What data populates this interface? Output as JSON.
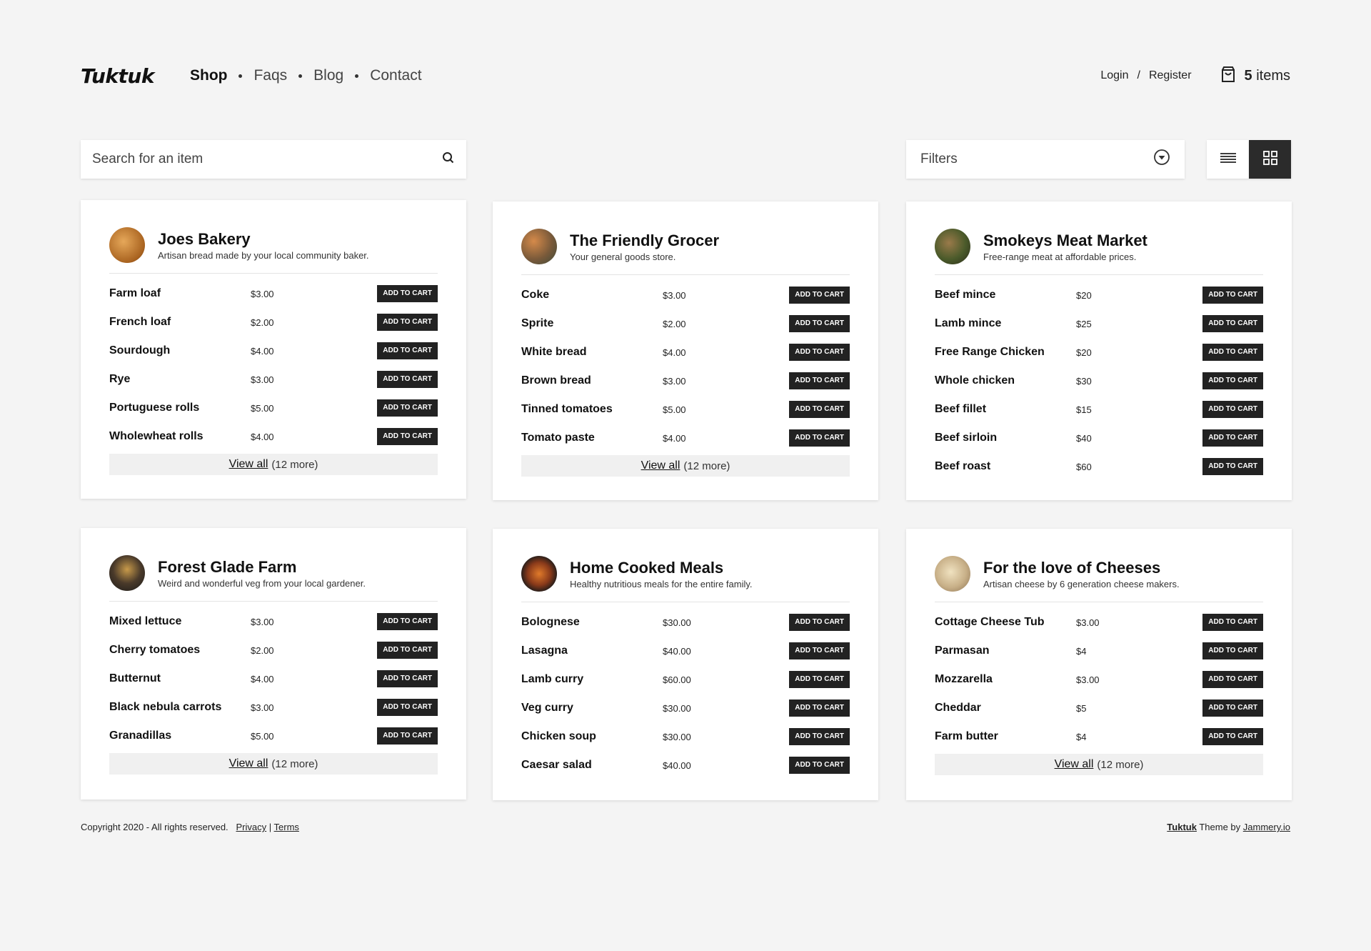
{
  "header": {
    "logo": "Tuktuk",
    "nav": [
      "Shop",
      "Faqs",
      "Blog",
      "Contact"
    ],
    "login": "Login",
    "separator": "/",
    "register": "Register",
    "cart_count": "5",
    "cart_suffix": " items"
  },
  "toolbar": {
    "search_placeholder": "Search for an item",
    "filters_label": "Filters"
  },
  "add_label": "Add to cart",
  "cards": [
    {
      "title": "Joes Bakery",
      "subtitle": "Artisan bread made by your local community baker.",
      "items": [
        {
          "name": "Farm loaf",
          "price": "$3.00"
        },
        {
          "name": "French loaf",
          "price": "$2.00"
        },
        {
          "name": "Sourdough",
          "price": "$4.00"
        },
        {
          "name": "Rye",
          "price": "$3.00"
        },
        {
          "name": "Portuguese rolls",
          "price": "$5.00"
        },
        {
          "name": "Wholewheat rolls",
          "price": "$4.00"
        }
      ],
      "view_all": "View all",
      "more": "(12 more)"
    },
    {
      "title": "The Friendly Grocer",
      "subtitle": "Your general goods store.",
      "items": [
        {
          "name": "Coke",
          "price": "$3.00"
        },
        {
          "name": "Sprite",
          "price": "$2.00"
        },
        {
          "name": "White bread",
          "price": "$4.00"
        },
        {
          "name": "Brown bread",
          "price": "$3.00"
        },
        {
          "name": "Tinned tomatoes",
          "price": "$5.00"
        },
        {
          "name": "Tomato paste",
          "price": "$4.00"
        }
      ],
      "view_all": "View all",
      "more": "(12 more)"
    },
    {
      "title": "Smokeys Meat Market",
      "subtitle": "Free-range meat at affordable prices.",
      "items": [
        {
          "name": "Beef mince",
          "price": "$20"
        },
        {
          "name": "Lamb mince",
          "price": "$25"
        },
        {
          "name": "Free Range Chicken",
          "price": "$20"
        },
        {
          "name": "Whole chicken",
          "price": "$30"
        },
        {
          "name": "Beef fillet",
          "price": "$15"
        },
        {
          "name": "Beef sirloin",
          "price": "$40"
        },
        {
          "name": "Beef roast",
          "price": "$60"
        }
      ]
    },
    {
      "title": "Forest Glade Farm",
      "subtitle": "Weird and wonderful veg from your local gardener.",
      "items": [
        {
          "name": "Mixed lettuce",
          "price": "$3.00"
        },
        {
          "name": "Cherry tomatoes",
          "price": "$2.00"
        },
        {
          "name": "Butternut",
          "price": "$4.00"
        },
        {
          "name": "Black nebula carrots",
          "price": "$3.00"
        },
        {
          "name": "Granadillas",
          "price": "$5.00"
        }
      ],
      "view_all": "View all",
      "more": "(12 more)"
    },
    {
      "title": "Home Cooked Meals",
      "subtitle": "Healthy nutritious meals for the entire family.",
      "items": [
        {
          "name": "Bolognese",
          "price": "$30.00"
        },
        {
          "name": "Lasagna",
          "price": "$40.00"
        },
        {
          "name": "Lamb curry",
          "price": "$60.00"
        },
        {
          "name": "Veg curry",
          "price": "$30.00"
        },
        {
          "name": "Chicken soup",
          "price": "$30.00"
        },
        {
          "name": "Caesar salad",
          "price": "$40.00"
        }
      ]
    },
    {
      "title": "For the love of Cheeses",
      "subtitle": "Artisan cheese by 6 generation cheese makers.",
      "items": [
        {
          "name": "Cottage Cheese Tub",
          "price": "$3.00"
        },
        {
          "name": "Parmasan",
          "price": "$4"
        },
        {
          "name": "Mozzarella",
          "price": "$3.00"
        },
        {
          "name": "Cheddar",
          "price": "$5"
        },
        {
          "name": "Farm butter",
          "price": "$4"
        }
      ],
      "view_all": "View all",
      "more": "(12 more)"
    }
  ],
  "footer": {
    "copyright": "Copyright 2020 - All rights reserved.",
    "privacy": "Privacy",
    "pipe": "|",
    "terms": "Terms",
    "brand": "Tuktuk",
    "theme_by": "Theme by",
    "author": "Jammery.io"
  },
  "colors": {
    "background": "#f4f4f4",
    "button": "#222222",
    "card": "#ffffff"
  }
}
